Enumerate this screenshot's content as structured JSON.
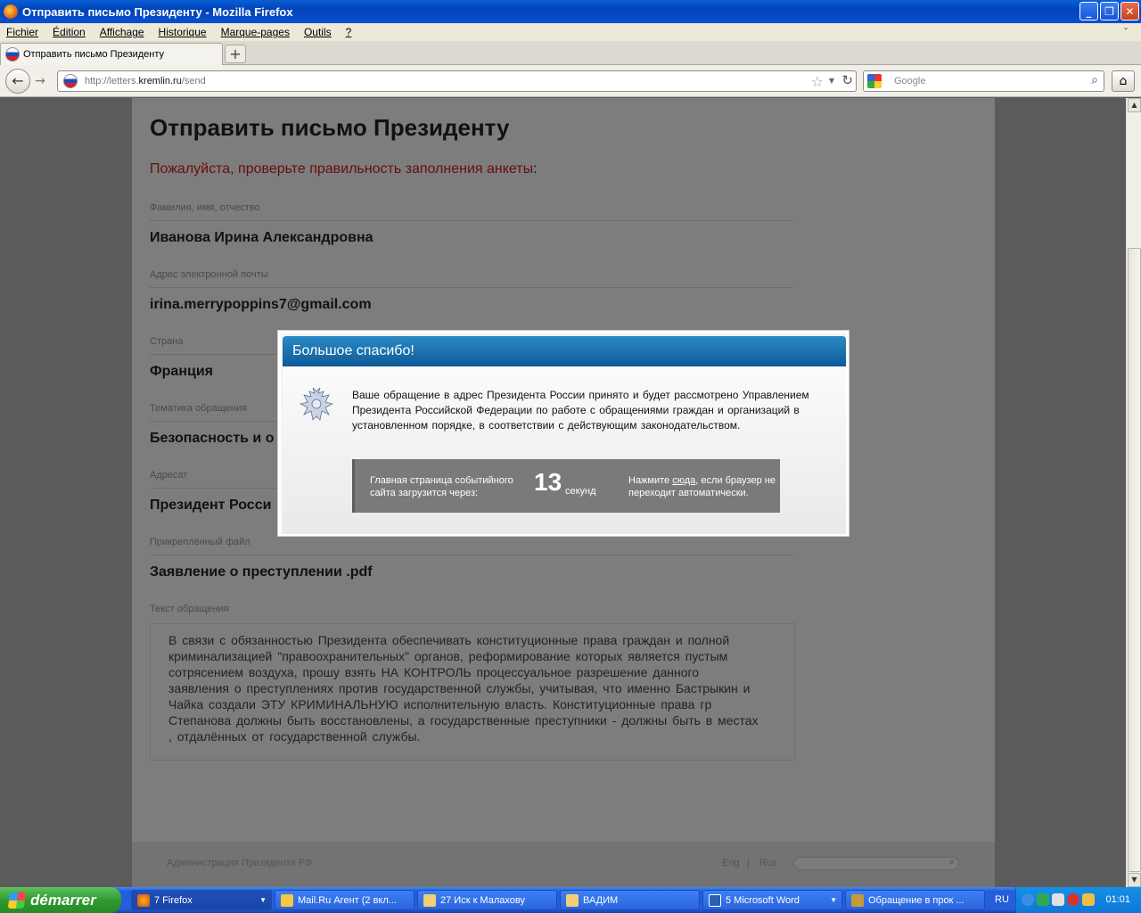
{
  "window": {
    "title": "Отправить письмо Президенту - Mozilla Firefox",
    "minimize": "_",
    "maximize": "❐",
    "close": "✕"
  },
  "menu": [
    "Fichier",
    "Édition",
    "Affichage",
    "Historique",
    "Marque-pages",
    "Outils",
    "?"
  ],
  "tab": {
    "label": "Отправить письмо Президенту",
    "new_tab": "+"
  },
  "nav": {
    "url_prefix": "http://letters.",
    "url_domain": "kremlin.ru",
    "url_path": "/send",
    "search_placeholder": "Google"
  },
  "page": {
    "heading": "Отправить письмо Президенту",
    "warning": "Пожалуйста, проверьте правильность заполнения анкеты",
    "warning_colon": ":",
    "fields": [
      {
        "label": "Фамилия, имя, отчество",
        "value": "Иванова Ирина Александровна"
      },
      {
        "label": "Адрес электронной почты",
        "value": "irina.merrypoppins7@gmail.com"
      },
      {
        "label": "Страна",
        "value": "Франция"
      },
      {
        "label": "Тематика обращения",
        "value": "Безопасность и о"
      },
      {
        "label": "Адресат",
        "value": "Президент Росси"
      },
      {
        "label": "Прикреплённый файл",
        "value": "Заявление о преступлении .pdf"
      }
    ],
    "message_label": "Текст обращения",
    "message_lines": [
      "В связи  с  обязанностью Президента  обеспечивать конституционные  права  граждан и полной",
      "криминализацией  \"правоохранительных\"  органов,  реформирование  которых является  пустым",
      "сотрясением воздуха,   прошу  взять   НА КОНТРОЛЬ процессуальное  разрешение  данного",
      "заявления о  преступлениях против государственной  службы,  учитывая, что именно  Бастрыкин и",
      "Чайка  создали  ЭТУ  КРИМИНАЛЬНУЮ исполнительную  власть.  Конституционные  права  гр",
      "Степанова  должны быть  восстановлены,  а государственные  преступники - должны быть в  местах",
      ", отдалённых  от  государственной  службы."
    ],
    "footer_admin": "Администрация Президента РФ",
    "footer_eng": "Eng",
    "footer_sep": "|",
    "footer_rus": "Rus"
  },
  "modal": {
    "title": "Большое спасибо!",
    "text": "Ваше обращение в адрес Президента России принято и будет рассмотрено Управлением Президента Российской Федерации по работе с обращениями граждан и организаций в установленном порядке, в соответствии с действующим законодательством.",
    "countdown_label": "Главная страница событийного сайта загрузится через:",
    "countdown_value": "13",
    "countdown_unit": "секунд",
    "hint_prefix": "Нажмите ",
    "hint_link": "сюда",
    "hint_suffix": ", если браузер не переходит автоматически."
  },
  "taskbar": {
    "start": "démarrer",
    "tasks": [
      "7 Firefox",
      "Mail.Ru Агент (2 вкл...",
      "27 Иск к Малахову",
      "ВАДИМ",
      "5 Microsoft Word",
      "Обращение в прок ..."
    ],
    "lang": "RU",
    "clock": "01:01"
  }
}
